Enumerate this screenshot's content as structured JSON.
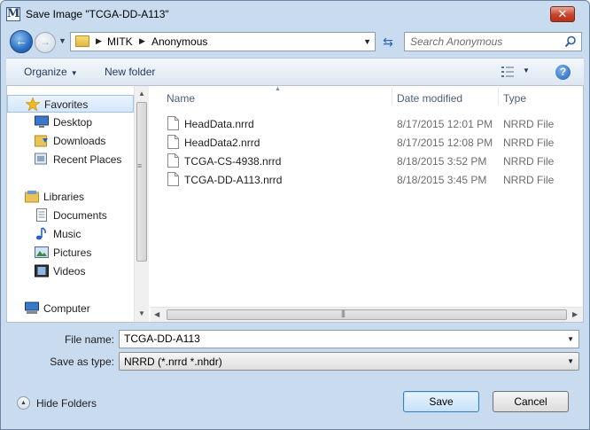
{
  "window": {
    "title": "Save Image \"TCGA-DD-A113\"",
    "app_icon_letter": "M",
    "close_glyph": "✕"
  },
  "nav": {
    "back_glyph": "←",
    "forward_glyph": "→",
    "recent_glyph": "▼",
    "breadcrumbs": [
      "MITK",
      "Anonymous"
    ],
    "refresh_glyph": "⇆",
    "search_placeholder": "Search Anonymous"
  },
  "commandbar": {
    "organize_label": "Organize",
    "new_folder_label": "New folder",
    "help_label": "?"
  },
  "sidebar": {
    "items": [
      {
        "label": "Favorites",
        "icon": "star-icon"
      },
      {
        "label": "Desktop",
        "icon": "desktop-icon"
      },
      {
        "label": "Downloads",
        "icon": "downloads-icon"
      },
      {
        "label": "Recent Places",
        "icon": "recent-places-icon"
      },
      {
        "label": "Libraries",
        "icon": "libraries-icon"
      },
      {
        "label": "Documents",
        "icon": "documents-icon"
      },
      {
        "label": "Music",
        "icon": "music-icon"
      },
      {
        "label": "Pictures",
        "icon": "pictures-icon"
      },
      {
        "label": "Videos",
        "icon": "videos-icon"
      },
      {
        "label": "Computer",
        "icon": "computer-icon"
      }
    ]
  },
  "filelist": {
    "columns": [
      "Name",
      "Date modified",
      "Type"
    ],
    "rows": [
      {
        "name": "HeadData.nrrd",
        "date": "8/17/2015 12:01 PM",
        "type": "NRRD File"
      },
      {
        "name": "HeadData2.nrrd",
        "date": "8/17/2015 12:08 PM",
        "type": "NRRD File"
      },
      {
        "name": "TCGA-CS-4938.nrrd",
        "date": "8/18/2015 3:52 PM",
        "type": "NRRD File"
      },
      {
        "name": "TCGA-DD-A113.nrrd",
        "date": "8/18/2015 3:45 PM",
        "type": "NRRD File"
      }
    ]
  },
  "form": {
    "filename_label": "File name:",
    "filename_value": "TCGA-DD-A113",
    "savetype_label": "Save as type:",
    "savetype_value": "NRRD (*.nrrd *.nhdr)"
  },
  "footer": {
    "hide_folders_label": "Hide Folders",
    "save_label": "Save",
    "cancel_label": "Cancel"
  },
  "colors": {
    "window_frame": "#c9dbef",
    "accent": "#2a6dc1",
    "close_red": "#c7432a"
  }
}
